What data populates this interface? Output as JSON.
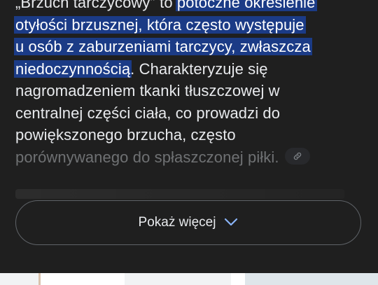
{
  "answer": {
    "lines": [
      {
        "parts": [
          {
            "text": "„Brzuch tarczycowy” to ",
            "highlight": false
          },
          {
            "text": "potoczne określenie",
            "highlight": true
          }
        ]
      },
      {
        "parts": [
          {
            "text": "otyłości brzusznej, która często występuje",
            "highlight": true
          }
        ]
      },
      {
        "parts": [
          {
            "text": "u osób z zaburzeniami tarczycy, zwłaszcza",
            "highlight": true
          }
        ]
      },
      {
        "parts": [
          {
            "text": "niedoczynnością",
            "highlight": true
          },
          {
            "text": ". Charakteryzuje się",
            "highlight": false
          }
        ]
      },
      {
        "parts": [
          {
            "text": "nagromadzeniem tkanki tłuszczowej w",
            "highlight": false
          }
        ]
      },
      {
        "parts": [
          {
            "text": "centralnej części ciała, co prowadzi do",
            "highlight": false
          }
        ]
      },
      {
        "parts": [
          {
            "text": "powiększonego brzucha, często",
            "highlight": false
          }
        ]
      },
      {
        "parts": [
          {
            "text": "porównywanego do spłaszczonej piłki.",
            "highlight": false
          }
        ],
        "faded": true,
        "has_link_chip": true
      }
    ]
  },
  "show_more": {
    "label": "Pokaż więcej",
    "icon": "chevron-down-icon"
  },
  "link_chip": {
    "icon": "link-icon"
  }
}
